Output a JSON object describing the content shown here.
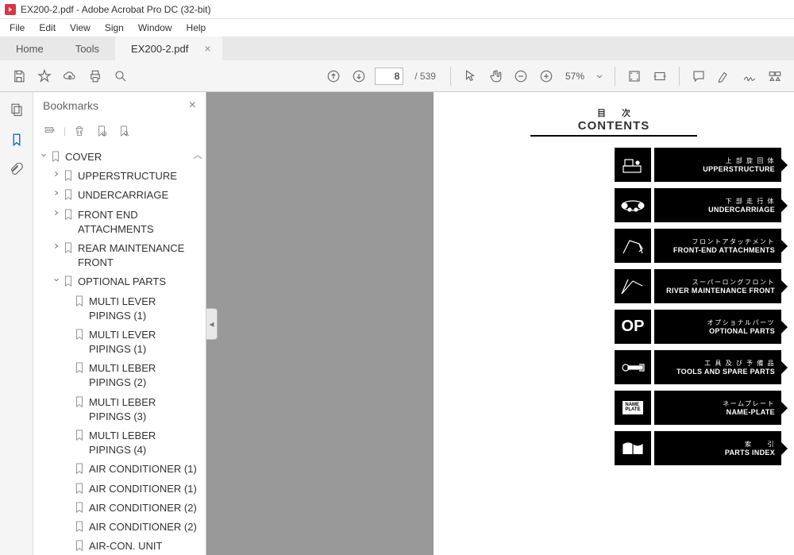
{
  "title": "EX200-2.pdf - Adobe Acrobat Pro DC (32-bit)",
  "menu": [
    "File",
    "Edit",
    "View",
    "Sign",
    "Window",
    "Help"
  ],
  "tabs": {
    "home": "Home",
    "tools": "Tools",
    "file": "EX200-2.pdf"
  },
  "toolbar": {
    "page": "8",
    "totalPages": "/ 539",
    "zoom": "57%"
  },
  "panel": {
    "title": "Bookmarks"
  },
  "bookmarks": {
    "cover": "COVER",
    "upper": "UPPERSTRUCTURE",
    "under": "UNDERCARRIAGE",
    "front": "FRONT END ATTACHMENTS",
    "rear": "REAR MAINTENANCE FRONT",
    "optional": "OPTIONAL PARTS",
    "children": [
      "MULTI LEVER PIPINGS (1)",
      "MULTI LEVER PIPINGS (1)",
      "MULTI LEBER PIPINGS (2)",
      "MULTI LEBER PIPINGS (3)",
      "MULTI LEBER PIPINGS (4)",
      "AIR CONDITIONER (1)",
      "AIR CONDITIONER (1)",
      "AIR CONDITIONER (2)",
      "AIR CONDITIONER (2)",
      "AIR-CON. UNIT"
    ]
  },
  "page": {
    "header_jp": "目次",
    "header_en": "CONTENTS",
    "rows": [
      {
        "jp": "上 部 旋 回 体",
        "en": "UPPERSTRUCTURE"
      },
      {
        "jp": "下 部 走 行 体",
        "en": "UNDERCARRIAGE"
      },
      {
        "jp": "フロントアタッチメント",
        "en": "FRONT-END ATTACHMENTS"
      },
      {
        "jp": "スーパーロングフロント",
        "en": "RIVER MAINTENANCE FRONT"
      },
      {
        "jp": "オプショナルパーツ",
        "en": "OPTIONAL PARTS"
      },
      {
        "jp": "工 具 及 び 予 備 品",
        "en": "TOOLS AND SPARE PARTS"
      },
      {
        "jp": "ネームプレート",
        "en": "NAME-PLATE"
      },
      {
        "jp": "索　　引",
        "en": "PARTS INDEX"
      }
    ]
  }
}
